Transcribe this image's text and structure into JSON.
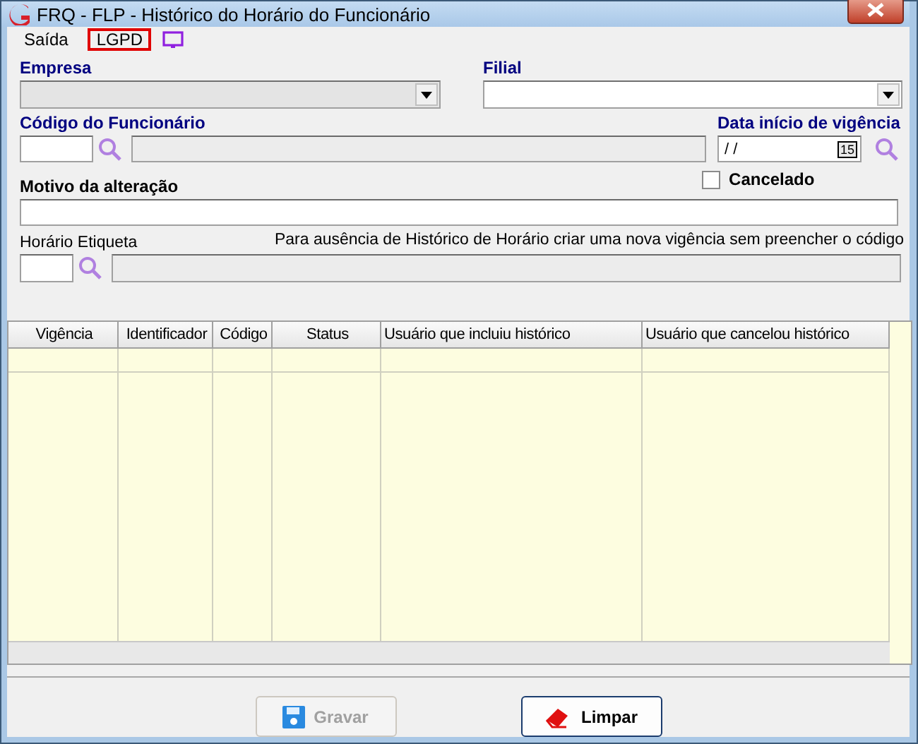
{
  "window": {
    "title": "FRQ - FLP - Histórico do Horário do Funcionário"
  },
  "menu": [
    {
      "label": "Saída",
      "highlighted": false
    },
    {
      "label": "LGPD",
      "highlighted": true
    }
  ],
  "empresa": {
    "label": "Empresa",
    "disabled": true
  },
  "filial": {
    "label": "Filial",
    "disabled": false
  },
  "codigo_funcionario": {
    "label": "Código do Funcionário"
  },
  "data_inicio_vigencia": {
    "label": "Data início de vigência",
    "value": "/ /",
    "calendar": "15"
  },
  "cancelado": {
    "label": "Cancelado",
    "checked": false
  },
  "motivo": {
    "label": "Motivo da alteração"
  },
  "horario_etiqueta": {
    "label": "Horário Etiqueta"
  },
  "note": "Para ausência de Histórico de Horário criar uma nova vigência sem preencher o código",
  "table": {
    "columns": [
      "Vigência",
      "Identificador",
      "Código",
      "Status",
      "Usuário que incluiu histórico",
      "Usuário que cancelou histórico"
    ]
  },
  "buttons": [
    {
      "label": "Gravar",
      "kind": "save",
      "disabled": true
    },
    {
      "label": "Limpar",
      "kind": "clear",
      "disabled": false
    }
  ]
}
